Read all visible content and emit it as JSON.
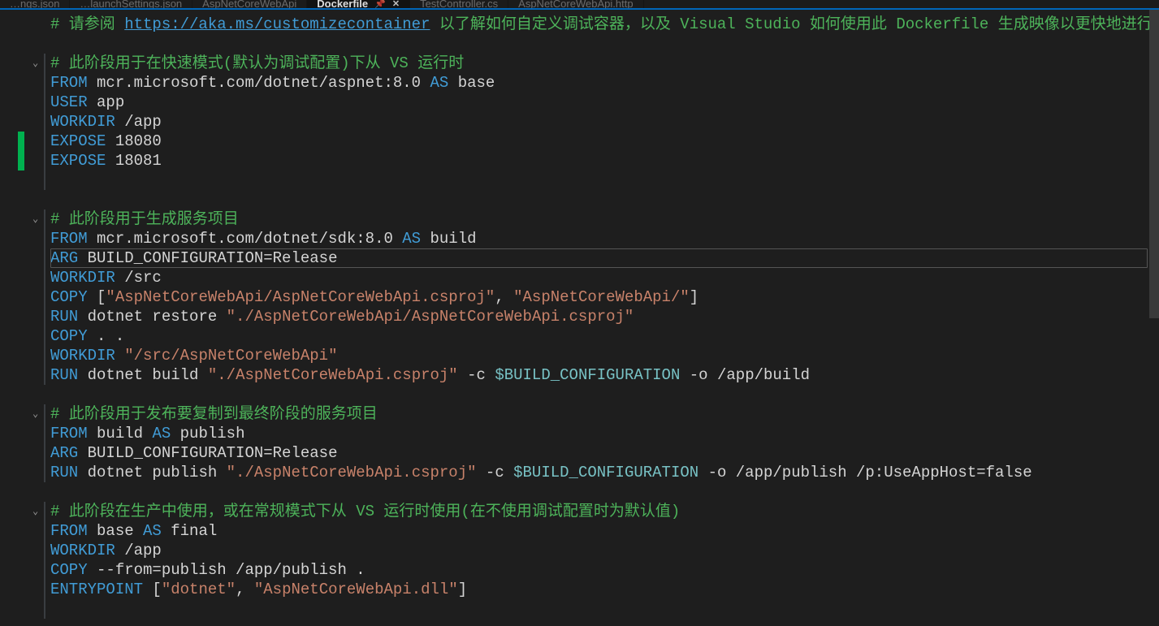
{
  "tabs": [
    {
      "label": "…ngs.json"
    },
    {
      "label": "…launchSettings.json"
    },
    {
      "label": "AspNetCoreWebApi"
    },
    {
      "label": "Dockerfile",
      "active": true,
      "pinned": true
    },
    {
      "label": "TestController.cs"
    },
    {
      "label": "AspNetCoreWebApi.http"
    }
  ],
  "selectedLineIndex": 12,
  "greenMark": {
    "start": 6,
    "end": 8
  },
  "foldChevrons": [
    2,
    10,
    20,
    25
  ],
  "blueBars": [
    {
      "start": 2,
      "end": 8
    },
    {
      "start": 10,
      "end": 18
    },
    {
      "start": 20,
      "end": 23
    },
    {
      "start": 25,
      "end": 30
    }
  ],
  "lines": [
    {
      "tokens": [
        {
          "t": "# 请参阅 ",
          "cls": "c"
        },
        {
          "t": "https://aka.ms/customizecontainer",
          "cls": "lk"
        },
        {
          "t": " 以了解如何自定义调试容器，以及 Visual Studio 如何使用此 Dockerfile 生成映像以更快地进行调试。",
          "cls": "c"
        }
      ]
    },
    {
      "tokens": []
    },
    {
      "tokens": [
        {
          "t": "# 此阶段用于在快速模式(默认为调试配置)下从 VS 运行时",
          "cls": "c"
        }
      ]
    },
    {
      "tokens": [
        {
          "t": "FROM",
          "cls": "kw"
        },
        {
          "t": " mcr.microsoft.com/dotnet/aspnet:8.0 ",
          "cls": "pl"
        },
        {
          "t": "AS",
          "cls": "kw2"
        },
        {
          "t": " base",
          "cls": "pl"
        }
      ]
    },
    {
      "tokens": [
        {
          "t": "USER",
          "cls": "kw"
        },
        {
          "t": " app",
          "cls": "pl"
        }
      ]
    },
    {
      "tokens": [
        {
          "t": "WORKDIR",
          "cls": "kw"
        },
        {
          "t": " /app",
          "cls": "pl"
        }
      ]
    },
    {
      "tokens": [
        {
          "t": "EXPOSE",
          "cls": "kw"
        },
        {
          "t": " 18080",
          "cls": "pl"
        }
      ]
    },
    {
      "tokens": [
        {
          "t": "EXPOSE",
          "cls": "kw"
        },
        {
          "t": " 18081",
          "cls": "pl"
        }
      ]
    },
    {
      "tokens": []
    },
    {
      "tokens": []
    },
    {
      "tokens": [
        {
          "t": "# 此阶段用于生成服务项目",
          "cls": "c"
        }
      ]
    },
    {
      "tokens": [
        {
          "t": "FROM",
          "cls": "kw"
        },
        {
          "t": " mcr.microsoft.com/dotnet/sdk:8.0 ",
          "cls": "pl"
        },
        {
          "t": "AS",
          "cls": "kw2"
        },
        {
          "t": " build",
          "cls": "pl"
        }
      ]
    },
    {
      "tokens": [
        {
          "t": "ARG",
          "cls": "kw"
        },
        {
          "t": " BUILD_CONFIGURATION=Release",
          "cls": "pl"
        }
      ]
    },
    {
      "tokens": [
        {
          "t": "WORKDIR",
          "cls": "kw"
        },
        {
          "t": " /src",
          "cls": "pl"
        }
      ]
    },
    {
      "tokens": [
        {
          "t": "COPY",
          "cls": "kw"
        },
        {
          "t": " [",
          "cls": "br"
        },
        {
          "t": "\"AspNetCoreWebApi/AspNetCoreWebApi.csproj\"",
          "cls": "s"
        },
        {
          "t": ", ",
          "cls": "pl"
        },
        {
          "t": "\"AspNetCoreWebApi/\"",
          "cls": "s"
        },
        {
          "t": "]",
          "cls": "br"
        }
      ]
    },
    {
      "tokens": [
        {
          "t": "RUN",
          "cls": "kw"
        },
        {
          "t": " dotnet restore ",
          "cls": "pl"
        },
        {
          "t": "\"./AspNetCoreWebApi/AspNetCoreWebApi.csproj\"",
          "cls": "s"
        }
      ]
    },
    {
      "tokens": [
        {
          "t": "COPY",
          "cls": "kw"
        },
        {
          "t": " . .",
          "cls": "pl"
        }
      ]
    },
    {
      "tokens": [
        {
          "t": "WORKDIR",
          "cls": "kw"
        },
        {
          "t": " ",
          "cls": "pl"
        },
        {
          "t": "\"/src/AspNetCoreWebApi\"",
          "cls": "s"
        }
      ]
    },
    {
      "tokens": [
        {
          "t": "RUN",
          "cls": "kw"
        },
        {
          "t": " dotnet build ",
          "cls": "pl"
        },
        {
          "t": "\"./AspNetCoreWebApi.csproj\"",
          "cls": "s"
        },
        {
          "t": " -c ",
          "cls": "pl"
        },
        {
          "t": "$BUILD_CONFIGURATION",
          "cls": "v"
        },
        {
          "t": " -o /app/build",
          "cls": "pl"
        }
      ]
    },
    {
      "tokens": []
    },
    {
      "tokens": [
        {
          "t": "# 此阶段用于发布要复制到最终阶段的服务项目",
          "cls": "c"
        }
      ]
    },
    {
      "tokens": [
        {
          "t": "FROM",
          "cls": "kw"
        },
        {
          "t": " build ",
          "cls": "pl"
        },
        {
          "t": "AS",
          "cls": "kw2"
        },
        {
          "t": " publish",
          "cls": "pl"
        }
      ]
    },
    {
      "tokens": [
        {
          "t": "ARG",
          "cls": "kw"
        },
        {
          "t": " BUILD_CONFIGURATION=Release",
          "cls": "pl"
        }
      ]
    },
    {
      "tokens": [
        {
          "t": "RUN",
          "cls": "kw"
        },
        {
          "t": " dotnet publish ",
          "cls": "pl"
        },
        {
          "t": "\"./AspNetCoreWebApi.csproj\"",
          "cls": "s"
        },
        {
          "t": " -c ",
          "cls": "pl"
        },
        {
          "t": "$BUILD_CONFIGURATION",
          "cls": "v"
        },
        {
          "t": " -o /app/publish /p:UseAppHost=false",
          "cls": "pl"
        }
      ]
    },
    {
      "tokens": []
    },
    {
      "tokens": [
        {
          "t": "# 此阶段在生产中使用，或在常规模式下从 VS 运行时使用(在不使用调试配置时为默认值)",
          "cls": "c"
        }
      ]
    },
    {
      "tokens": [
        {
          "t": "FROM",
          "cls": "kw"
        },
        {
          "t": " base ",
          "cls": "pl"
        },
        {
          "t": "AS",
          "cls": "kw2"
        },
        {
          "t": " final",
          "cls": "pl"
        }
      ]
    },
    {
      "tokens": [
        {
          "t": "WORKDIR",
          "cls": "kw"
        },
        {
          "t": " /app",
          "cls": "pl"
        }
      ]
    },
    {
      "tokens": [
        {
          "t": "COPY",
          "cls": "kw"
        },
        {
          "t": " --from=publish /app/publish .",
          "cls": "pl"
        }
      ]
    },
    {
      "tokens": [
        {
          "t": "ENTRYPOINT",
          "cls": "kw"
        },
        {
          "t": " [",
          "cls": "br"
        },
        {
          "t": "\"dotnet\"",
          "cls": "s"
        },
        {
          "t": ", ",
          "cls": "pl"
        },
        {
          "t": "\"AspNetCoreWebApi.dll\"",
          "cls": "s"
        },
        {
          "t": "]",
          "cls": "br"
        }
      ]
    }
  ]
}
